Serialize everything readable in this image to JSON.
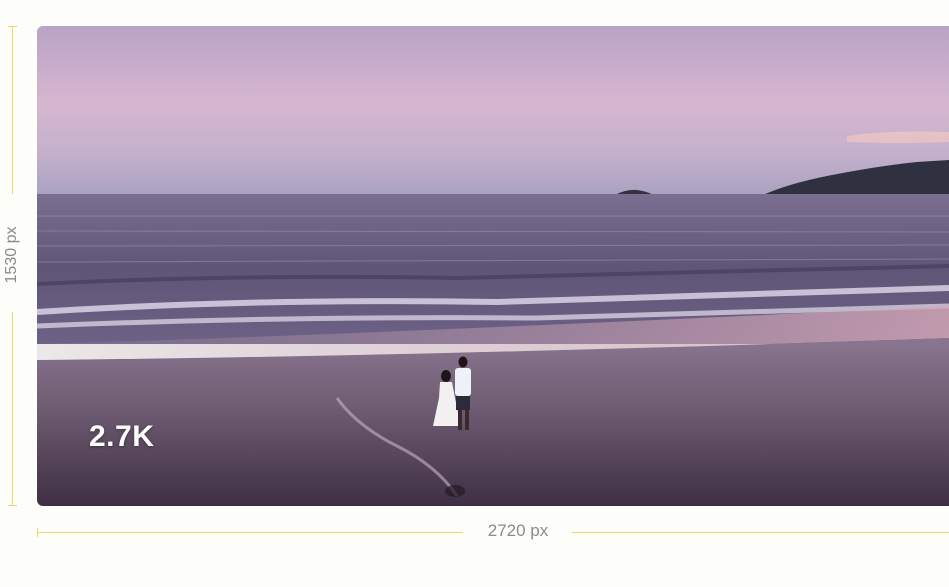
{
  "image": {
    "resolution_label": "2.7K",
    "height_label": "1530 px",
    "width_label": "2720 px"
  },
  "colors": {
    "accent_line": "#e9d96a",
    "label_gray": "#8b8b8b",
    "background": "#fdfdf9"
  }
}
